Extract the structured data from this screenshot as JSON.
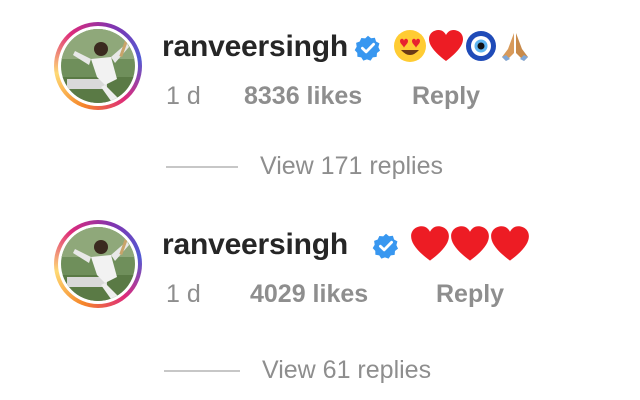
{
  "comments": [
    {
      "username": "ranveersingh",
      "verified": true,
      "emoji_icons": [
        "heart-eyes-emoji-icon",
        "red-heart-icon",
        "nazar-amulet-icon",
        "folded-hands-icon"
      ],
      "time": "1 d",
      "likes": "8336 likes",
      "reply_label": "Reply",
      "view_replies": "View 171 replies"
    },
    {
      "username": "ranveersingh",
      "verified": true,
      "emoji_icons": [
        "red-heart-icon",
        "red-heart-icon",
        "red-heart-icon"
      ],
      "time": "1 d",
      "likes": "4029 likes",
      "reply_label": "Reply",
      "view_replies": "View 61 replies"
    }
  ],
  "colors": {
    "username": "#262626",
    "meta": "#8e8e8e",
    "verified_blue": "#3897f0",
    "heart_red": "#ed1c24",
    "divider": "#c7c7c7"
  }
}
